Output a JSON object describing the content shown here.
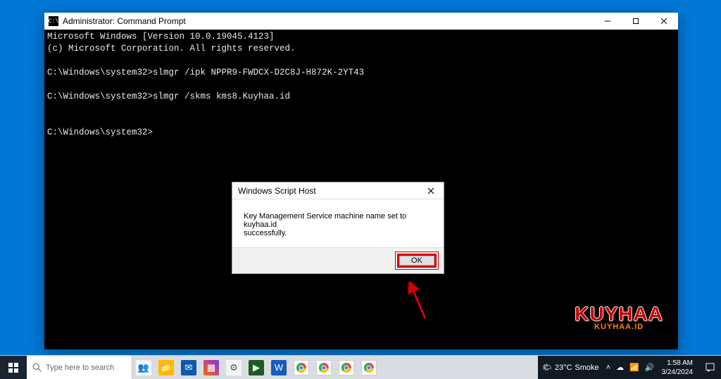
{
  "cmd_window": {
    "title": "Administrator: Command Prompt",
    "line1": "Microsoft Windows [Version 10.0.19045.4123]",
    "line2": "(c) Microsoft Corporation. All rights reserved.",
    "line3": "C:\\Windows\\system32>slmgr /ipk NPPR9-FWDCX-D2C8J-H872K-2YT43",
    "line4": "C:\\Windows\\system32>slmgr /skms kms8.Kuyhaa.id",
    "line5": "C:\\Windows\\system32>"
  },
  "dialog": {
    "title": "Windows Script Host",
    "message_l1": "Key Management Service machine name set to kuyhaa.id",
    "message_l2": "successfully.",
    "ok_label": "OK"
  },
  "watermark": {
    "big": "KUYHAA",
    "small": "KUYHAA.ID"
  },
  "taskbar": {
    "search_placeholder": "Type here to search",
    "weather_temp": "23°C",
    "weather_cond": "Smoke",
    "time": "1:58 AM",
    "date": "3/24/2024"
  }
}
